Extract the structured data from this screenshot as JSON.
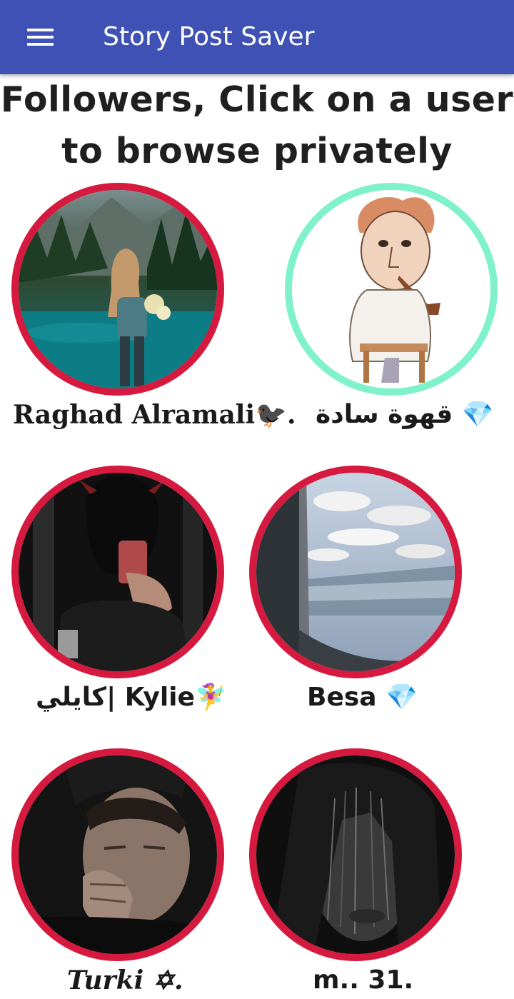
{
  "appbar": {
    "title": "Story Post Saver",
    "menu_icon": "hamburger-menu-icon",
    "color": "#3f51b5"
  },
  "heading": {
    "line1": "Followers, Click on a user",
    "line2": "to browse privately"
  },
  "colors": {
    "ring_red": "#d6193e",
    "ring_mint": "#7ff2c9"
  },
  "followers": [
    {
      "name": "Raghad Alramali🐦‍⬛.",
      "ring": "red"
    },
    {
      "name": "قهوة سادة 💎",
      "ring": "mint"
    },
    {
      "name": "كايلي| Kylie🧚‍♀️",
      "ring": "red"
    },
    {
      "name": "Besa 💎",
      "ring": "red"
    },
    {
      "name": "Turki ✡.",
      "ring": "red"
    },
    {
      "name": "m.. 31.",
      "ring": "red"
    }
  ]
}
